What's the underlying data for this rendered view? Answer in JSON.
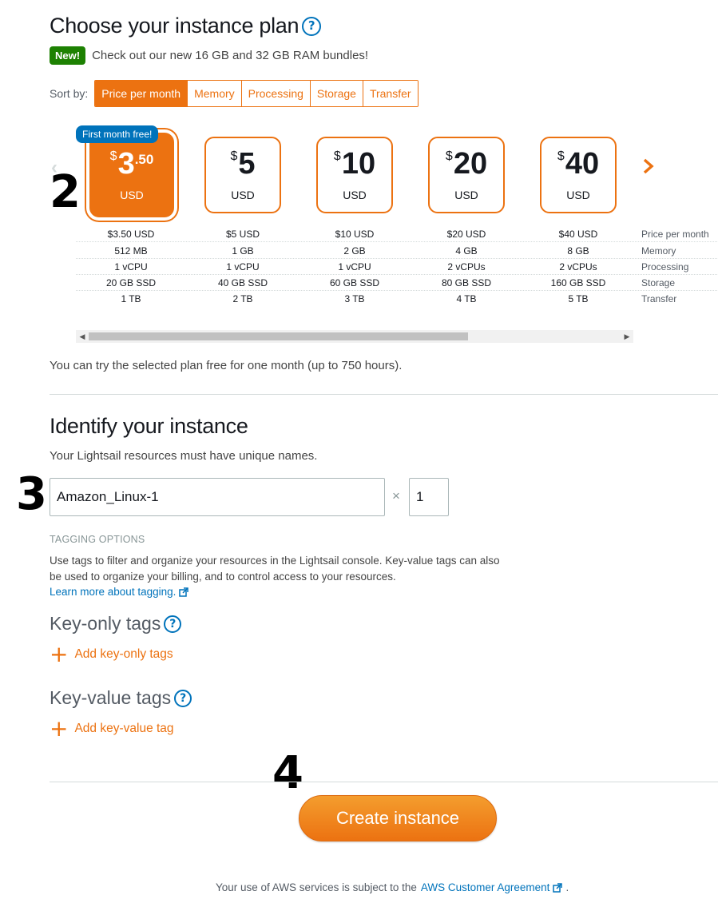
{
  "plan_section": {
    "title": "Choose your instance plan",
    "new_badge": "New!",
    "promo": "Check out our new 16 GB and 32 GB RAM bundles!",
    "sort_label": "Sort by:",
    "sort_options": [
      "Price per month",
      "Memory",
      "Processing",
      "Storage",
      "Transfer"
    ],
    "selected_sort": "Price per month",
    "free_badge": "First month free!",
    "cards": [
      {
        "symbol": "$",
        "amount": "3",
        "cents": ".50",
        "currency": "USD",
        "selected": true
      },
      {
        "symbol": "$",
        "amount": "5",
        "cents": "",
        "currency": "USD",
        "selected": false
      },
      {
        "symbol": "$",
        "amount": "10",
        "cents": "",
        "currency": "USD",
        "selected": false
      },
      {
        "symbol": "$",
        "amount": "20",
        "cents": "",
        "currency": "USD",
        "selected": false
      },
      {
        "symbol": "$",
        "amount": "40",
        "cents": "",
        "currency": "USD",
        "selected": false
      }
    ],
    "spec_rows": [
      {
        "label": "Price per month",
        "values": [
          "$3.50 USD",
          "$5 USD",
          "$10 USD",
          "$20 USD",
          "$40 USD"
        ]
      },
      {
        "label": "Memory",
        "values": [
          "512 MB",
          "1 GB",
          "2 GB",
          "4 GB",
          "8 GB"
        ]
      },
      {
        "label": "Processing",
        "values": [
          "1 vCPU",
          "1 vCPU",
          "1 vCPU",
          "2 vCPUs",
          "2 vCPUs"
        ]
      },
      {
        "label": "Storage",
        "values": [
          "20 GB SSD",
          "40 GB SSD",
          "60 GB SSD",
          "80 GB SSD",
          "160 GB SSD"
        ]
      },
      {
        "label": "Transfer",
        "values": [
          "1 TB",
          "2 TB",
          "3 TB",
          "4 TB",
          "5 TB"
        ]
      }
    ],
    "free_note": "You can try the selected plan free for one month (up to 750 hours).",
    "prev_icon": "chevron-left-icon",
    "next_icon": "chevron-right-icon"
  },
  "identify_section": {
    "title": "Identify your instance",
    "subtitle": "Your Lightsail resources must have unique names.",
    "name_value": "Amazon_Linux-1",
    "multiply_symbol": "×",
    "count_value": "1",
    "tagging_title": "TAGGING OPTIONS",
    "tagging_desc_line1": "Use tags to filter and organize your resources in the Lightsail console. Key-value tags can also",
    "tagging_desc_line2": "be used to organize your billing, and to control access to your resources.",
    "learn_more": "Learn more about tagging.",
    "key_only_title": "Key-only tags",
    "add_key_only": "Add key-only tags",
    "key_value_title": "Key-value tags",
    "add_key_value": "Add key-value tag"
  },
  "actions": {
    "create_button": "Create instance"
  },
  "footer": {
    "prefix": "Your use of AWS services is subject to the",
    "link": "AWS Customer Agreement",
    "suffix": "."
  },
  "step_markers": [
    "2",
    "3",
    "4"
  ],
  "colors": {
    "accent": "#ec7211",
    "link": "#0073bb",
    "new_badge": "#1d8102",
    "free_badge": "#0073bb"
  }
}
